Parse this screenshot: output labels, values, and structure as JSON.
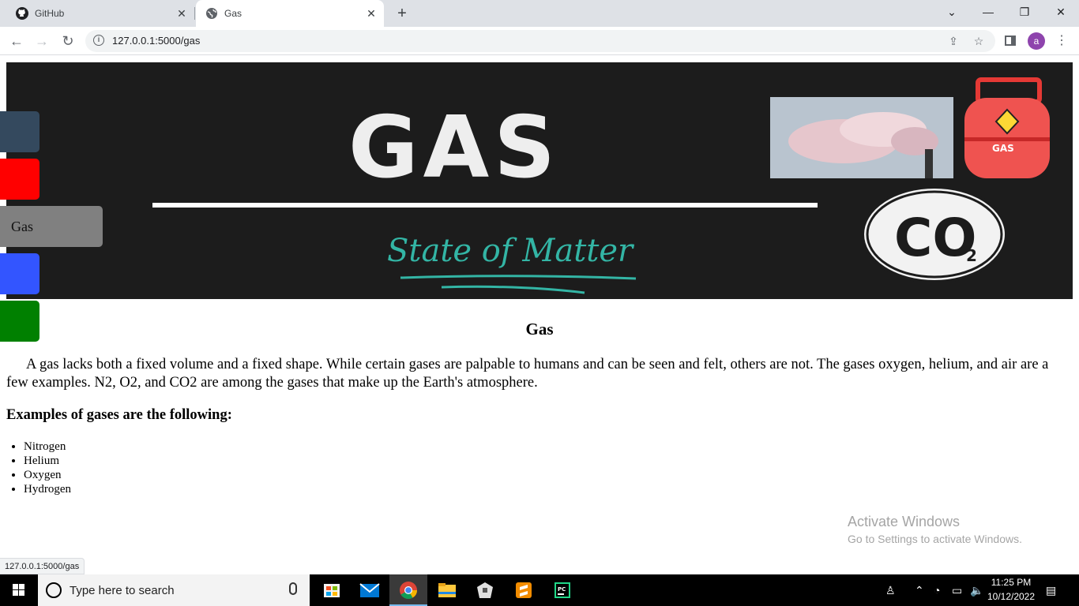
{
  "browser": {
    "tabs": [
      {
        "title": "GitHub",
        "icon": "github-icon"
      },
      {
        "title": "Gas",
        "icon": "globe-icon"
      }
    ],
    "new_tab": "+",
    "url": "127.0.0.1:5000/gas",
    "avatar_letter": "a"
  },
  "banner": {
    "title": "GAS",
    "subtitle": "State of Matter",
    "cylinder_label": "GAS",
    "co2_text": "CO",
    "co2_sub": "2"
  },
  "side_nav": {
    "active_label": "Gas",
    "colors": [
      "#34495e",
      "#ff0000",
      "#808080",
      "#3355ff",
      "#008000"
    ]
  },
  "content": {
    "heading": "Gas",
    "paragraph": "A gas lacks both a fixed volume and a fixed shape. While certain gases are palpable to humans and can be seen and felt, others are not. The gases oxygen, helium, and air are a few examples. N2, O2, and CO2 are among the gases that make up the Earth's atmosphere.",
    "examples_heading": "Examples of gases are the following:",
    "examples": [
      "Nitrogen",
      "Helium",
      "Oxygen",
      "Hydrogen"
    ]
  },
  "watermark": {
    "line1": "Activate Windows",
    "line2": "Go to Settings to activate Windows."
  },
  "status_url": "127.0.0.1:5000/gas",
  "taskbar": {
    "search_placeholder": "Type here to search",
    "time": "11:25 PM",
    "date": "10/12/2022"
  }
}
